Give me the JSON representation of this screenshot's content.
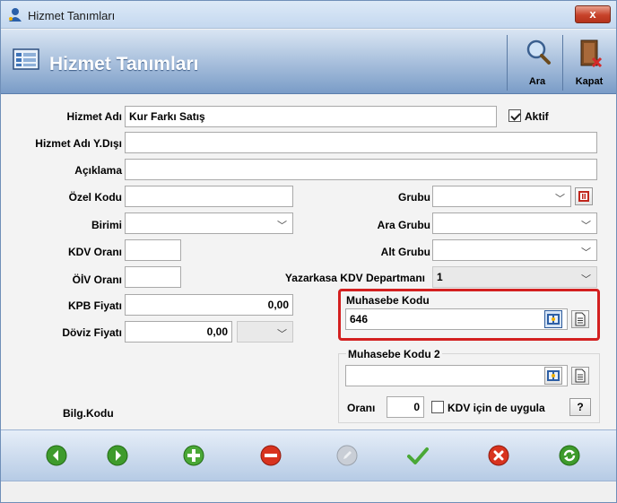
{
  "window": {
    "title": "Hizmet Tanımları",
    "close_label": "x"
  },
  "header": {
    "title": "Hizmet Tanımları"
  },
  "toolbar": {
    "search_label": "Ara",
    "close_label": "Kapat"
  },
  "form": {
    "service_name": {
      "label": "Hizmet Adı",
      "value": "Kur Farkı Satış"
    },
    "active": {
      "label": "Aktif",
      "checked": true
    },
    "service_name_foreign": {
      "label": "Hizmet Adı Y.Dışı",
      "value": ""
    },
    "description": {
      "label": "Açıklama",
      "value": ""
    },
    "special_code": {
      "label": "Özel Kodu",
      "value": ""
    },
    "unit": {
      "label": "Birimi",
      "value": ""
    },
    "vat_rate": {
      "label": "KDV Oranı",
      "value": ""
    },
    "oiv_rate": {
      "label": "ÖİV Oranı",
      "value": ""
    },
    "kpb_price": {
      "label": "KPB Fiyatı",
      "value": "0,00"
    },
    "fx_price": {
      "label": "Döviz Fiyatı",
      "value": "0,00",
      "currency": ""
    },
    "group": {
      "label": "Grubu",
      "value": ""
    },
    "sub_group": {
      "label": "Ara Grubu",
      "value": ""
    },
    "lower_group": {
      "label": "Alt Grubu",
      "value": ""
    },
    "cash_register_dept": {
      "label": "Yazarkasa KDV Departmanı",
      "value": "1"
    },
    "account_code": {
      "label": "Muhasebe Kodu",
      "value": "646"
    },
    "account_code_2": {
      "label": "Muhasebe Kodu 2",
      "value": ""
    },
    "ratio": {
      "label": "Oranı",
      "value": "0"
    },
    "apply_vat": {
      "label": "KDV için de uygula",
      "checked": false
    },
    "help_label": "?",
    "info_code_label": "Bilg.Kodu"
  },
  "colors": {
    "accent_highlight": "#d32020",
    "header_gradient_top": "#d9e5f3",
    "header_gradient_bottom": "#7a9cc7"
  }
}
